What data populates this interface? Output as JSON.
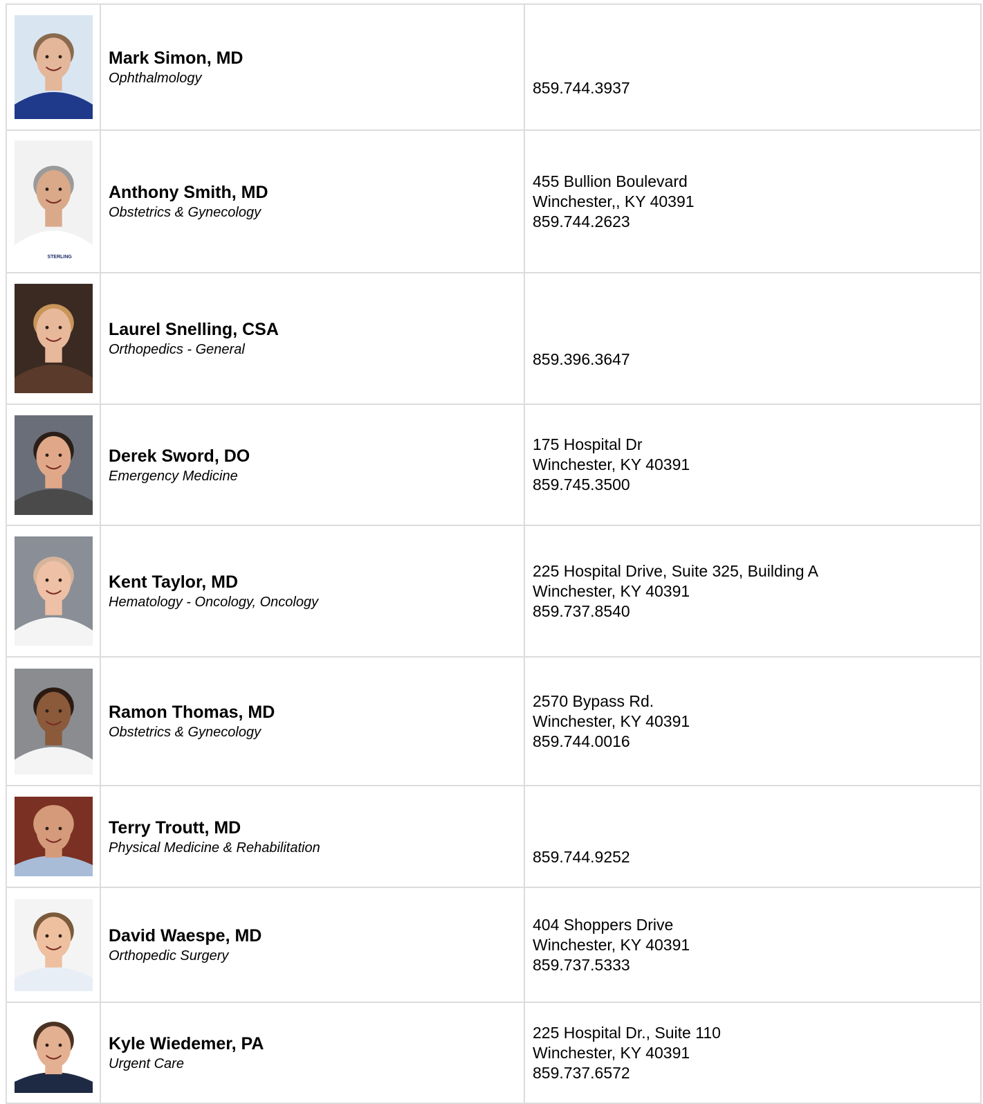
{
  "providers": [
    {
      "name": "Mark Simon, MD",
      "specialty": "Ophthalmology",
      "address_line1": "",
      "address_line2": "",
      "phone": "859.744.3937",
      "photo_bg": "#d9e6f2",
      "photo_shirt": "#1f3a8a",
      "photo_skin": "#e4b79a",
      "photo_hair": "#8a6a4e"
    },
    {
      "name": "Anthony Smith, MD",
      "specialty": "Obstetrics & Gynecology",
      "address_line1": "455 Bullion Boulevard",
      "address_line2": "Winchester,, KY 40391",
      "phone": "859.744.2623",
      "photo_bg": "#f2f2f2",
      "photo_shirt": "#ffffff",
      "photo_skin": "#d9a98a",
      "photo_hair": "#9a9a9a",
      "photo_logo": "STERLING"
    },
    {
      "name": "Laurel Snelling, CSA",
      "specialty": "Orthopedics - General",
      "address_line1": "",
      "address_line2": "",
      "phone": "859.396.3647",
      "photo_bg": "#3a2a22",
      "photo_shirt": "#5a3a2a",
      "photo_skin": "#e8b89a",
      "photo_hair": "#c8955a"
    },
    {
      "name": "Derek Sword, DO",
      "specialty": "Emergency Medicine",
      "address_line1": "175 Hospital Dr",
      "address_line2": "Winchester, KY 40391",
      "phone": "859.745.3500",
      "photo_bg": "#6a6e78",
      "photo_shirt": "#4a4a4a",
      "photo_skin": "#e0a888",
      "photo_hair": "#2a1e18"
    },
    {
      "name": "Kent Taylor, MD",
      "specialty": "Hematology - Oncology, Oncology",
      "address_line1": "225 Hospital Drive, Suite 325, Building A",
      "address_line2": "Winchester, KY 40391",
      "phone": "859.737.8540",
      "photo_bg": "#8a8e96",
      "photo_shirt": "#f4f4f4",
      "photo_skin": "#eec0a6",
      "photo_hair": "#d6b49a"
    },
    {
      "name": "Ramon Thomas, MD",
      "specialty": "Obstetrics & Gynecology",
      "address_line1": "2570 Bypass Rd.",
      "address_line2": "Winchester, KY 40391",
      "phone": "859.744.0016",
      "photo_bg": "#8a8c90",
      "photo_shirt": "#f4f4f4",
      "photo_skin": "#8a5a3a",
      "photo_hair": "#2a1a12"
    },
    {
      "name": "Terry Troutt, MD",
      "specialty": "Physical Medicine & Rehabilitation",
      "address_line1": "",
      "address_line2": "",
      "phone": "859.744.9252",
      "photo_bg": "#7a3022",
      "photo_shirt": "#a8bcd8",
      "photo_skin": "#d49a7a",
      "photo_hair": "#d49a7a"
    },
    {
      "name": "David Waespe, MD",
      "specialty": "Orthopedic Surgery",
      "address_line1": "404 Shoppers Drive",
      "address_line2": "Winchester, KY 40391",
      "phone": "859.737.5333",
      "photo_bg": "#f4f4f4",
      "photo_shirt": "#e8eef6",
      "photo_skin": "#eec0a0",
      "photo_hair": "#7a5a3a"
    },
    {
      "name": "Kyle Wiedemer, PA",
      "specialty": "Urgent Care",
      "address_line1": "225 Hospital Dr., Suite 110",
      "address_line2": "Winchester, KY 40391",
      "phone": "859.737.6572",
      "photo_bg": "#ffffff",
      "photo_shirt": "#1e2a44",
      "photo_skin": "#e4b092",
      "photo_hair": "#4a3222"
    }
  ]
}
